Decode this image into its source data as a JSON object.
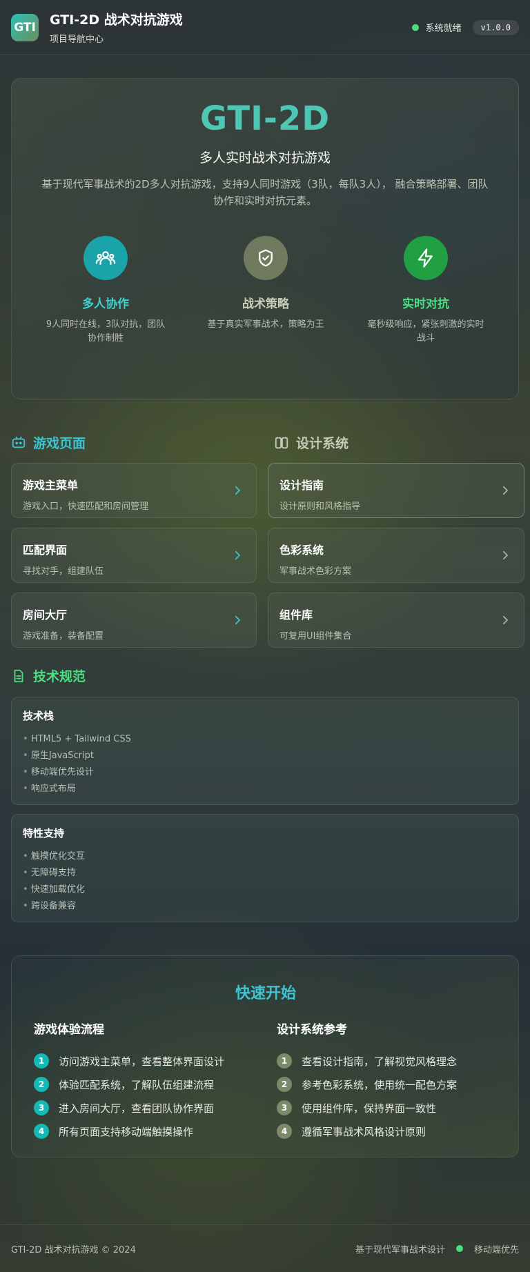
{
  "header": {
    "logo_text": "GTI",
    "title": "GTI-2D 战术对抗游戏",
    "subtitle": "项目导航中心",
    "status_text": "系统就绪",
    "version": "v1.0.0"
  },
  "hero": {
    "title": "GTI-2D",
    "subtitle": "多人实时战术对抗游戏",
    "description": "基于现代军事战术的2D多人对抗游戏，支持9人同时游戏（3队，每队3人）， 融合策略部署、团队协作和实时对抗元素。",
    "features": [
      {
        "icon": "users-icon",
        "title": "多人协作",
        "desc": "9人同时在线，3队对抗，团队协作制胜",
        "color": "#3fd3cf",
        "icon_bg": "#1aa3a8"
      },
      {
        "icon": "shield-check-icon",
        "title": "战术策略",
        "desc": "基于真实军事战术，策略为王",
        "color": "#c9cfb9",
        "icon_bg": "#6f7a5f"
      },
      {
        "icon": "lightning-icon",
        "title": "实时对抗",
        "desc": "毫秒级响应，紧张刺激的实时战斗",
        "color": "#4ade80",
        "icon_bg": "#21a043"
      }
    ]
  },
  "sections": {
    "game_pages": {
      "title": "游戏页面",
      "icon": "gamepad-icon",
      "color": "#3ec3d3"
    },
    "design_system": {
      "title": "设计系统",
      "icon": "columns-icon",
      "color": "#c5cab9"
    },
    "tech_spec": {
      "title": "技术规范",
      "icon": "document-icon",
      "color": "#4ade80"
    }
  },
  "game_pages": [
    {
      "title": "游戏主菜单",
      "desc": "游戏入口，快速匹配和房间管理"
    },
    {
      "title": "匹配界面",
      "desc": "寻找对手，组建队伍"
    },
    {
      "title": "房间大厅",
      "desc": "游戏准备，装备配置"
    }
  ],
  "design_pages": [
    {
      "title": "设计指南",
      "desc": "设计原则和风格指导"
    },
    {
      "title": "色彩系统",
      "desc": "军事战术色彩方案"
    },
    {
      "title": "组件库",
      "desc": "可复用UI组件集合"
    }
  ],
  "tech_stack": {
    "title": "技术栈",
    "items": [
      "HTML5 + Tailwind CSS",
      "原生JavaScript",
      "移动端优先设计",
      "响应式布局"
    ]
  },
  "features_support": {
    "title": "特性支持",
    "items": [
      "触摸优化交互",
      "无障碍支持",
      "快速加载优化",
      "跨设备兼容"
    ]
  },
  "quick_start": {
    "title": "快速开始",
    "game_flow": {
      "title": "游戏体验流程",
      "steps": [
        "访问游戏主菜单，查看整体界面设计",
        "体验匹配系统，了解队伍组建流程",
        "进入房间大厅，查看团队协作界面",
        "所有页面支持移动端触摸操作"
      ]
    },
    "design_ref": {
      "title": "设计系统参考",
      "steps": [
        "查看设计指南，了解视觉风格理念",
        "参考色彩系统，使用统一配色方案",
        "使用组件库，保持界面一致性",
        "遵循军事战术风格设计原则"
      ]
    },
    "step_numbers": [
      "1",
      "2",
      "3",
      "4"
    ]
  },
  "footer": {
    "left": "GTI-2D 战术对抗游戏 © 2024",
    "right_a": "基于现代军事战术设计",
    "right_b": "移动端优先"
  },
  "colors": {
    "accent_teal": "#3ec3d3",
    "accent_green": "#4ade80",
    "step_teal": "#14b8b4",
    "step_olive": "#7c8a6a"
  }
}
